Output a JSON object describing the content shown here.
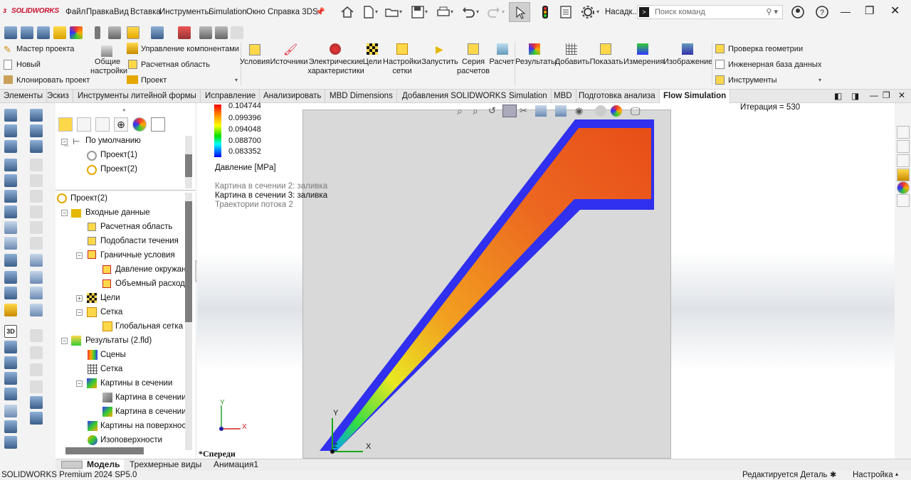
{
  "app": {
    "logo_text": "SOLIDWORKS",
    "menu": [
      "Файл",
      "Правка",
      "Вид",
      "Вставка",
      "Инструменты",
      "Simulation",
      "Окно",
      "Справка 3DS"
    ],
    "options_label": "Насадк...",
    "search_placeholder": "Поиск команд"
  },
  "ribbon": {
    "left_items": [
      "Мастер проекта",
      "Новый",
      "Клонировать проект"
    ],
    "general_settings": "Общие\nнастройки",
    "component_control": "Управление компонентами",
    "computational_domain": "Расчетная область",
    "project": "Проект",
    "buttons": [
      {
        "label": "Условия"
      },
      {
        "label": "Источники"
      },
      {
        "label": "Электрические\nхарактеристики"
      },
      {
        "label": "Цели"
      },
      {
        "label": "Настройки\nсетки"
      },
      {
        "label": "Запустить"
      },
      {
        "label": "Серия\nрасчетов"
      },
      {
        "label": "Расчет"
      },
      {
        "label": "Результаты"
      },
      {
        "label": "Добавить"
      },
      {
        "label": "Показать"
      },
      {
        "label": "Измерения"
      },
      {
        "label": "Изображение"
      }
    ],
    "right_items": [
      "Проверка геометрии",
      "Инженерная база данных",
      "Инструменты"
    ]
  },
  "tabs": [
    {
      "label": "Элементы",
      "active": false
    },
    {
      "label": "Эскиз",
      "active": false
    },
    {
      "label": "Инструменты литейной формы",
      "active": false
    },
    {
      "label": "Исправление",
      "active": false
    },
    {
      "label": "Анализировать",
      "active": false
    },
    {
      "label": "MBD Dimensions",
      "active": false
    },
    {
      "label": "Добавления SOLIDWORKS",
      "active": false
    },
    {
      "label": "Simulation",
      "active": false
    },
    {
      "label": "MBD",
      "active": false
    },
    {
      "label": "Подготовка анализа",
      "active": false
    },
    {
      "label": "Flow Simulation",
      "active": true
    }
  ],
  "tree": {
    "upper": [
      {
        "label": "По умолчанию"
      },
      {
        "label": "Проект(1)"
      },
      {
        "label": "Проект(2)"
      }
    ],
    "lower": [
      {
        "label": "Проект(2)"
      },
      {
        "label": "Входные данные"
      },
      {
        "label": "Расчетная область"
      },
      {
        "label": "Подобласти течения"
      },
      {
        "label": "Граничные условия"
      },
      {
        "label": "Давление окружан"
      },
      {
        "label": "Объемный расход"
      },
      {
        "label": "Цели"
      },
      {
        "label": "Сетка"
      },
      {
        "label": "Глобальная сетка"
      },
      {
        "label": "Результаты (2.fld)"
      },
      {
        "label": "Сцены"
      },
      {
        "label": "Сетка"
      },
      {
        "label": "Картины в сечении"
      },
      {
        "label": "Картина в сечении"
      },
      {
        "label": "Картина в сечении"
      },
      {
        "label": "Картины на поверхнос"
      },
      {
        "label": "Изоповерхности"
      }
    ]
  },
  "viewport": {
    "legend_values": [
      "0.104744",
      "0.099396",
      "0.094048",
      "0.088700",
      "0.083352"
    ],
    "legend_title": "Давление [MPa]",
    "plot_list": [
      {
        "label": "Картина в сечении 2: заливка",
        "active": false
      },
      {
        "label": "Картина в сечении 3: заливка",
        "active": true
      },
      {
        "label": "Траектории потока 2",
        "active": false
      }
    ],
    "iteration": "Итерация = 530",
    "view_name": "*Спереди",
    "triad_x": "X",
    "triad_y": "Y",
    "triad_z": "Z"
  },
  "bottom_tabs": [
    {
      "label": "Модель",
      "active": true
    },
    {
      "label": "Трехмерные виды",
      "active": false
    },
    {
      "label": "Анимация1",
      "active": false
    }
  ],
  "status": {
    "left": "SOLIDWORKS Premium 2024 SP5.0",
    "editing": "Редактируется Деталь",
    "custom": "Настройка"
  },
  "colors": {
    "accent": "#c8102e",
    "pressure_high": "#ff4000",
    "wall_blue": "#2b2bff"
  }
}
